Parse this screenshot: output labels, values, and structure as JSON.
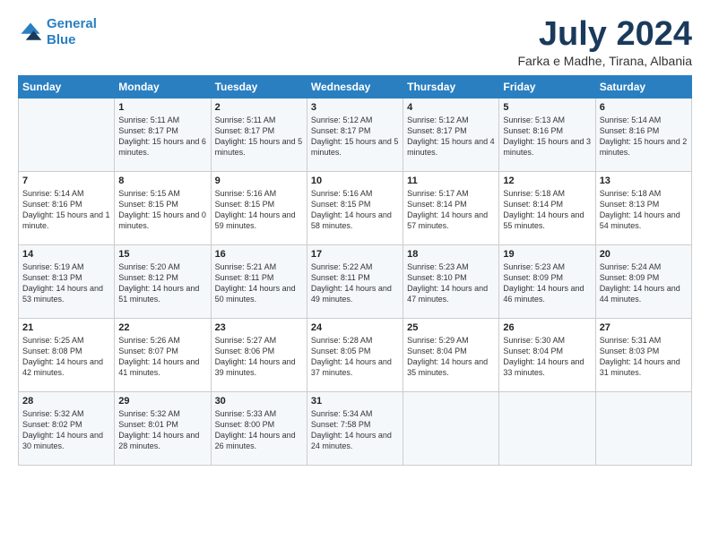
{
  "logo": {
    "line1": "General",
    "line2": "Blue"
  },
  "title": "July 2024",
  "subtitle": "Farka e Madhe, Tirana, Albania",
  "headers": [
    "Sunday",
    "Monday",
    "Tuesday",
    "Wednesday",
    "Thursday",
    "Friday",
    "Saturday"
  ],
  "weeks": [
    [
      {
        "day": "",
        "sunrise": "",
        "sunset": "",
        "daylight": ""
      },
      {
        "day": "1",
        "sunrise": "Sunrise: 5:11 AM",
        "sunset": "Sunset: 8:17 PM",
        "daylight": "Daylight: 15 hours and 6 minutes."
      },
      {
        "day": "2",
        "sunrise": "Sunrise: 5:11 AM",
        "sunset": "Sunset: 8:17 PM",
        "daylight": "Daylight: 15 hours and 5 minutes."
      },
      {
        "day": "3",
        "sunrise": "Sunrise: 5:12 AM",
        "sunset": "Sunset: 8:17 PM",
        "daylight": "Daylight: 15 hours and 5 minutes."
      },
      {
        "day": "4",
        "sunrise": "Sunrise: 5:12 AM",
        "sunset": "Sunset: 8:17 PM",
        "daylight": "Daylight: 15 hours and 4 minutes."
      },
      {
        "day": "5",
        "sunrise": "Sunrise: 5:13 AM",
        "sunset": "Sunset: 8:16 PM",
        "daylight": "Daylight: 15 hours and 3 minutes."
      },
      {
        "day": "6",
        "sunrise": "Sunrise: 5:14 AM",
        "sunset": "Sunset: 8:16 PM",
        "daylight": "Daylight: 15 hours and 2 minutes."
      }
    ],
    [
      {
        "day": "7",
        "sunrise": "Sunrise: 5:14 AM",
        "sunset": "Sunset: 8:16 PM",
        "daylight": "Daylight: 15 hours and 1 minute."
      },
      {
        "day": "8",
        "sunrise": "Sunrise: 5:15 AM",
        "sunset": "Sunset: 8:15 PM",
        "daylight": "Daylight: 15 hours and 0 minutes."
      },
      {
        "day": "9",
        "sunrise": "Sunrise: 5:16 AM",
        "sunset": "Sunset: 8:15 PM",
        "daylight": "Daylight: 14 hours and 59 minutes."
      },
      {
        "day": "10",
        "sunrise": "Sunrise: 5:16 AM",
        "sunset": "Sunset: 8:15 PM",
        "daylight": "Daylight: 14 hours and 58 minutes."
      },
      {
        "day": "11",
        "sunrise": "Sunrise: 5:17 AM",
        "sunset": "Sunset: 8:14 PM",
        "daylight": "Daylight: 14 hours and 57 minutes."
      },
      {
        "day": "12",
        "sunrise": "Sunrise: 5:18 AM",
        "sunset": "Sunset: 8:14 PM",
        "daylight": "Daylight: 14 hours and 55 minutes."
      },
      {
        "day": "13",
        "sunrise": "Sunrise: 5:18 AM",
        "sunset": "Sunset: 8:13 PM",
        "daylight": "Daylight: 14 hours and 54 minutes."
      }
    ],
    [
      {
        "day": "14",
        "sunrise": "Sunrise: 5:19 AM",
        "sunset": "Sunset: 8:13 PM",
        "daylight": "Daylight: 14 hours and 53 minutes."
      },
      {
        "day": "15",
        "sunrise": "Sunrise: 5:20 AM",
        "sunset": "Sunset: 8:12 PM",
        "daylight": "Daylight: 14 hours and 51 minutes."
      },
      {
        "day": "16",
        "sunrise": "Sunrise: 5:21 AM",
        "sunset": "Sunset: 8:11 PM",
        "daylight": "Daylight: 14 hours and 50 minutes."
      },
      {
        "day": "17",
        "sunrise": "Sunrise: 5:22 AM",
        "sunset": "Sunset: 8:11 PM",
        "daylight": "Daylight: 14 hours and 49 minutes."
      },
      {
        "day": "18",
        "sunrise": "Sunrise: 5:23 AM",
        "sunset": "Sunset: 8:10 PM",
        "daylight": "Daylight: 14 hours and 47 minutes."
      },
      {
        "day": "19",
        "sunrise": "Sunrise: 5:23 AM",
        "sunset": "Sunset: 8:09 PM",
        "daylight": "Daylight: 14 hours and 46 minutes."
      },
      {
        "day": "20",
        "sunrise": "Sunrise: 5:24 AM",
        "sunset": "Sunset: 8:09 PM",
        "daylight": "Daylight: 14 hours and 44 minutes."
      }
    ],
    [
      {
        "day": "21",
        "sunrise": "Sunrise: 5:25 AM",
        "sunset": "Sunset: 8:08 PM",
        "daylight": "Daylight: 14 hours and 42 minutes."
      },
      {
        "day": "22",
        "sunrise": "Sunrise: 5:26 AM",
        "sunset": "Sunset: 8:07 PM",
        "daylight": "Daylight: 14 hours and 41 minutes."
      },
      {
        "day": "23",
        "sunrise": "Sunrise: 5:27 AM",
        "sunset": "Sunset: 8:06 PM",
        "daylight": "Daylight: 14 hours and 39 minutes."
      },
      {
        "day": "24",
        "sunrise": "Sunrise: 5:28 AM",
        "sunset": "Sunset: 8:05 PM",
        "daylight": "Daylight: 14 hours and 37 minutes."
      },
      {
        "day": "25",
        "sunrise": "Sunrise: 5:29 AM",
        "sunset": "Sunset: 8:04 PM",
        "daylight": "Daylight: 14 hours and 35 minutes."
      },
      {
        "day": "26",
        "sunrise": "Sunrise: 5:30 AM",
        "sunset": "Sunset: 8:04 PM",
        "daylight": "Daylight: 14 hours and 33 minutes."
      },
      {
        "day": "27",
        "sunrise": "Sunrise: 5:31 AM",
        "sunset": "Sunset: 8:03 PM",
        "daylight": "Daylight: 14 hours and 31 minutes."
      }
    ],
    [
      {
        "day": "28",
        "sunrise": "Sunrise: 5:32 AM",
        "sunset": "Sunset: 8:02 PM",
        "daylight": "Daylight: 14 hours and 30 minutes."
      },
      {
        "day": "29",
        "sunrise": "Sunrise: 5:32 AM",
        "sunset": "Sunset: 8:01 PM",
        "daylight": "Daylight: 14 hours and 28 minutes."
      },
      {
        "day": "30",
        "sunrise": "Sunrise: 5:33 AM",
        "sunset": "Sunset: 8:00 PM",
        "daylight": "Daylight: 14 hours and 26 minutes."
      },
      {
        "day": "31",
        "sunrise": "Sunrise: 5:34 AM",
        "sunset": "Sunset: 7:58 PM",
        "daylight": "Daylight: 14 hours and 24 minutes."
      },
      {
        "day": "",
        "sunrise": "",
        "sunset": "",
        "daylight": ""
      },
      {
        "day": "",
        "sunrise": "",
        "sunset": "",
        "daylight": ""
      },
      {
        "day": "",
        "sunrise": "",
        "sunset": "",
        "daylight": ""
      }
    ]
  ]
}
